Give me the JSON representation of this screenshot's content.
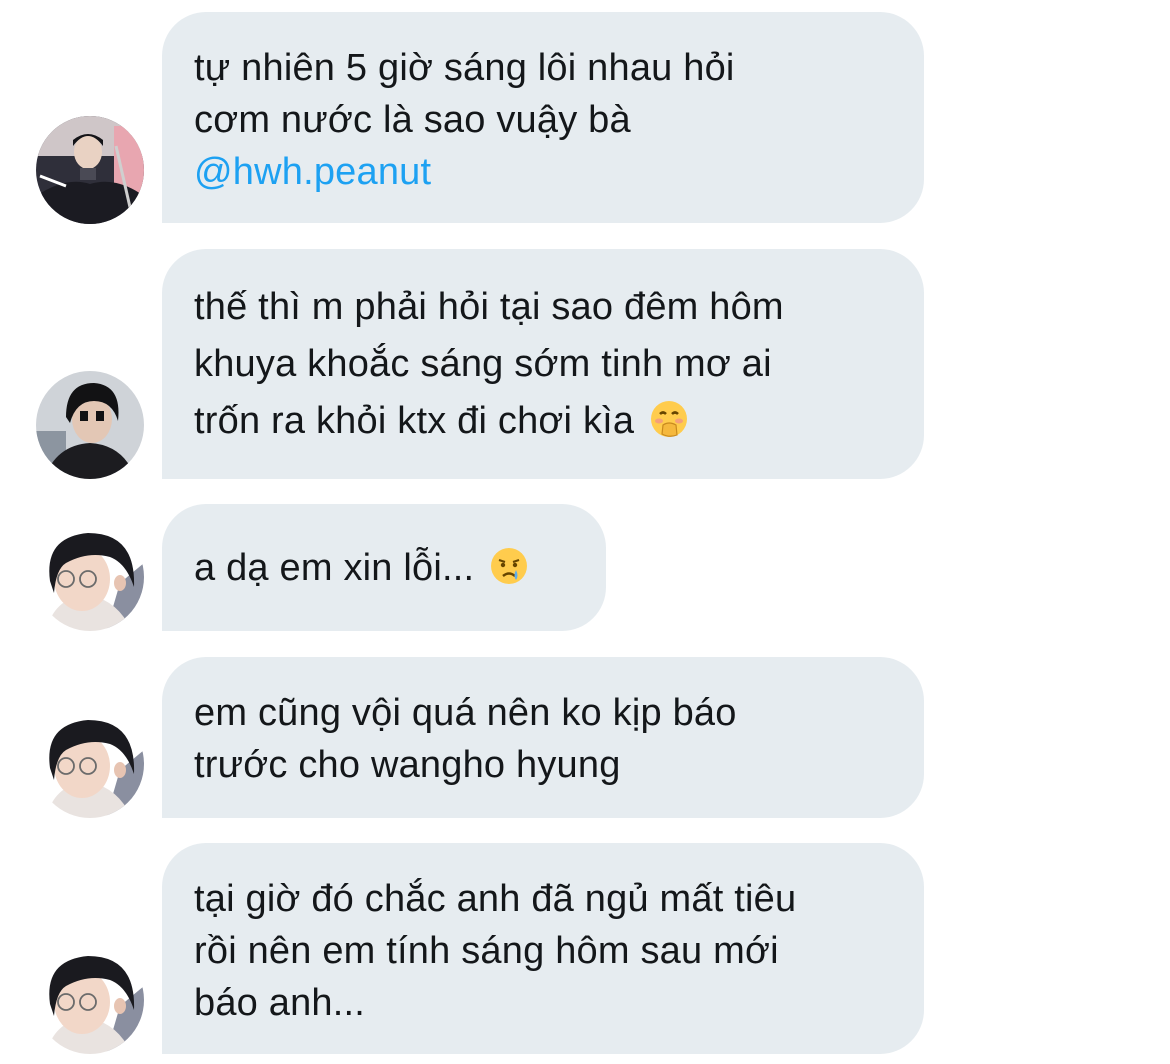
{
  "messages": [
    {
      "avatar": "user-avatar-1",
      "lines": [
        "tự nhiên 5 giờ sáng lôi nhau hỏi",
        "cơm nước là sao vuậy bà"
      ],
      "mention": "@hwh.peanut"
    },
    {
      "avatar": "user-avatar-2",
      "lines": [
        "thế thì m phải hỏi tại sao đêm hôm",
        "khuya khoắc sáng sớm tinh mơ ai",
        "trốn ra khỏi ktx đi chơi kìa"
      ],
      "emoji": "face-with-hand-over-mouth-icon"
    },
    {
      "avatar": "user-avatar-3",
      "lines": [
        "a dạ em xin lỗi..."
      ],
      "emoji": "crying-face-icon"
    },
    {
      "avatar": "user-avatar-3",
      "lines": [
        "em cũng vội quá nên ko kịp báo",
        "trước cho wangho hyung"
      ]
    },
    {
      "avatar": "user-avatar-3",
      "lines": [
        "tại giờ đó chắc anh đã ngủ mất tiêu",
        "rồi nên em tính sáng hôm sau mới",
        "báo anh..."
      ]
    }
  ],
  "colors": {
    "bubble_bg": "#e6ecf0",
    "text": "#14171a",
    "mention": "#1da1f2"
  }
}
